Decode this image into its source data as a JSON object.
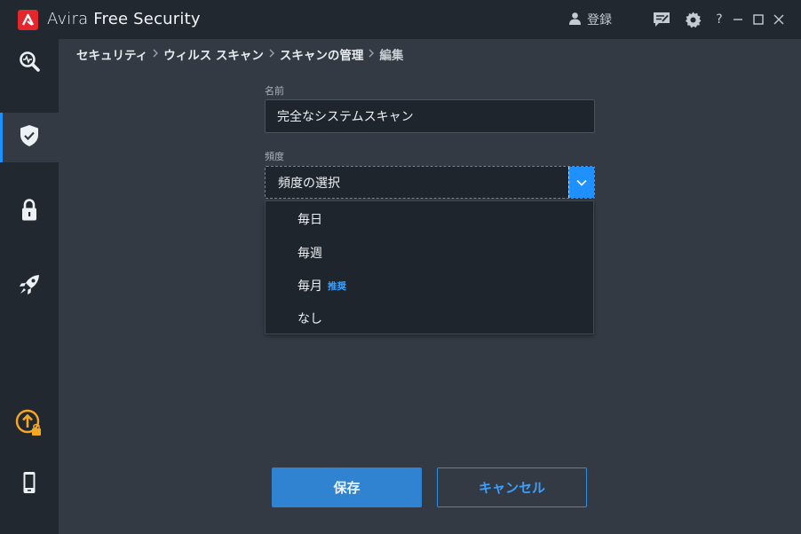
{
  "app": {
    "title_brand": "Avira",
    "title_product": "Free Security",
    "register_label": "登録",
    "help_label": "?"
  },
  "icons": {
    "logo": "avira-logo-icon",
    "user": "user-icon",
    "feedback": "feedback-icon",
    "settings": "gear-icon",
    "minimize": "minimize-icon",
    "maximize": "maximize-icon",
    "close": "close-icon"
  },
  "sidebar": {
    "items": [
      {
        "name": "scan-icon",
        "active": false
      },
      {
        "name": "shield-icon",
        "active": true
      },
      {
        "name": "lock-icon",
        "active": false
      },
      {
        "name": "rocket-icon",
        "active": false
      },
      {
        "name": "upgrade-icon",
        "active": false
      },
      {
        "name": "mobile-icon",
        "active": false
      }
    ]
  },
  "breadcrumb": {
    "items": [
      "セキュリティ",
      "ウィルス スキャン",
      "スキャンの管理",
      "編集"
    ]
  },
  "form": {
    "name_label": "名前",
    "name_value": "完全なシステムスキャン",
    "frequency_label": "頻度",
    "frequency_placeholder": "頻度の選択",
    "options": [
      {
        "label": "毎日",
        "badge": ""
      },
      {
        "label": "毎週",
        "badge": ""
      },
      {
        "label": "毎月",
        "badge": "推奨"
      },
      {
        "label": "なし",
        "badge": ""
      }
    ]
  },
  "buttons": {
    "save": "保存",
    "cancel": "キャンセル"
  },
  "colors": {
    "accent": "#1e90ff",
    "brand_red": "#e4272d",
    "upgrade_orange": "#f5a623"
  }
}
